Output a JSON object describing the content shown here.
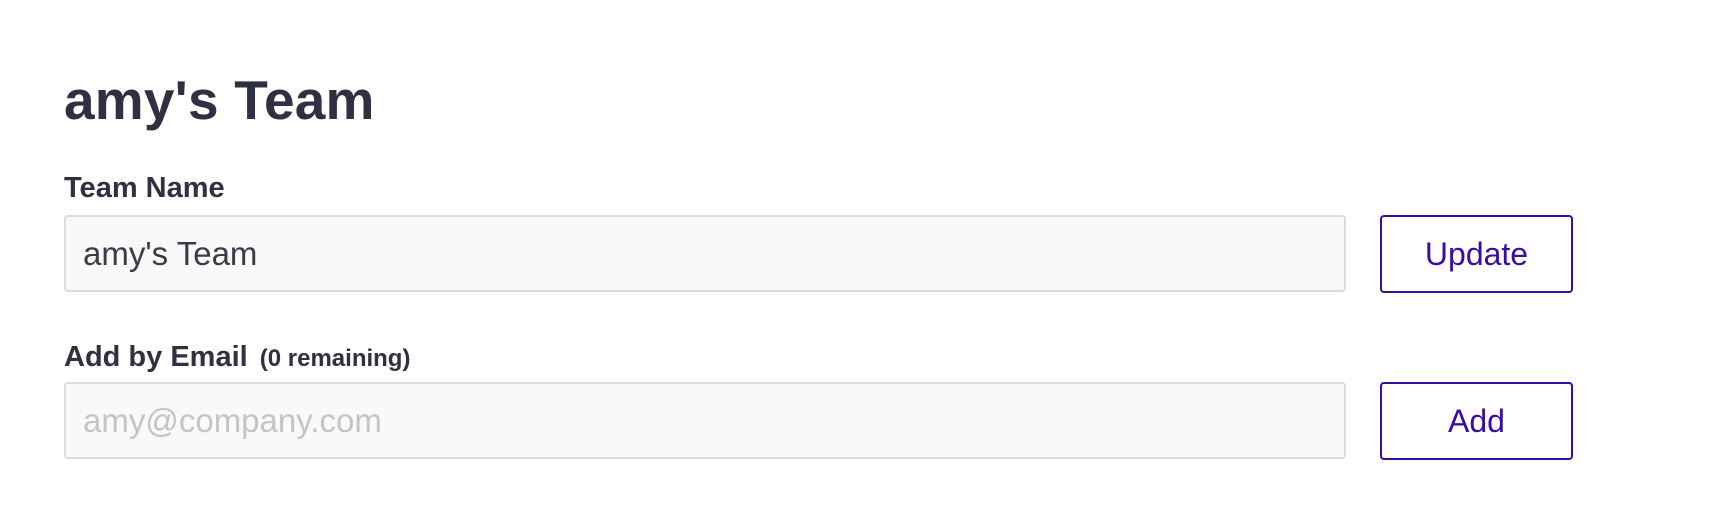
{
  "page": {
    "title": "amy's Team"
  },
  "team_name": {
    "label": "Team Name",
    "value": "amy's Team",
    "button_label": "Update"
  },
  "add_by_email": {
    "label": "Add by Email",
    "remaining_text": "(0 remaining)",
    "value": "",
    "placeholder": "amy@company.com",
    "button_label": "Add"
  },
  "colors": {
    "accent": "#3a0ca3",
    "text": "#2f3142",
    "input_background": "#f9f9f9",
    "input_border": "#dcdcdc",
    "placeholder": "#c4c4c4"
  }
}
